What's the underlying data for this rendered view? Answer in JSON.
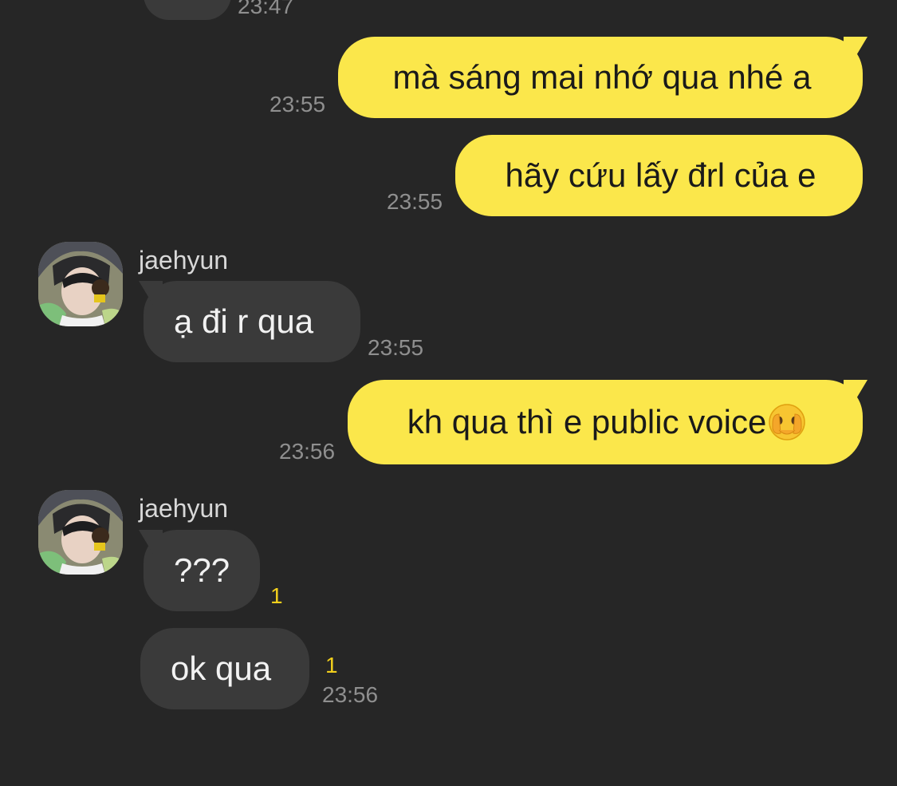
{
  "conversation": {
    "prev_time": "23:47",
    "messages": [
      {
        "id": "m1",
        "direction": "outgoing",
        "text": "mà sáng mai nhớ qua nhé a",
        "time": "23:55"
      },
      {
        "id": "m2",
        "direction": "outgoing",
        "text": "hãy cứu lấy đrl của e",
        "time": "23:55"
      },
      {
        "id": "m3",
        "direction": "incoming",
        "sender": "jaehyun",
        "text": "ạ đi r qua",
        "time": "23:55"
      },
      {
        "id": "m4",
        "direction": "outgoing",
        "text": "kh qua thì e public voice",
        "emoji": "face-with-hand-over-mouth-icon",
        "time": "23:56"
      },
      {
        "id": "m5",
        "direction": "incoming",
        "sender": "jaehyun",
        "text": "???",
        "unread": "1"
      },
      {
        "id": "m6",
        "direction": "incoming",
        "text": "ok qua",
        "unread": "1",
        "time": "23:56"
      }
    ]
  },
  "colors": {
    "background": "#262626",
    "outgoing_bubble": "#fbe74b",
    "incoming_bubble": "#3a3a3a",
    "timestamp": "#8f8f8f",
    "unread_count": "#f2cf1c"
  }
}
